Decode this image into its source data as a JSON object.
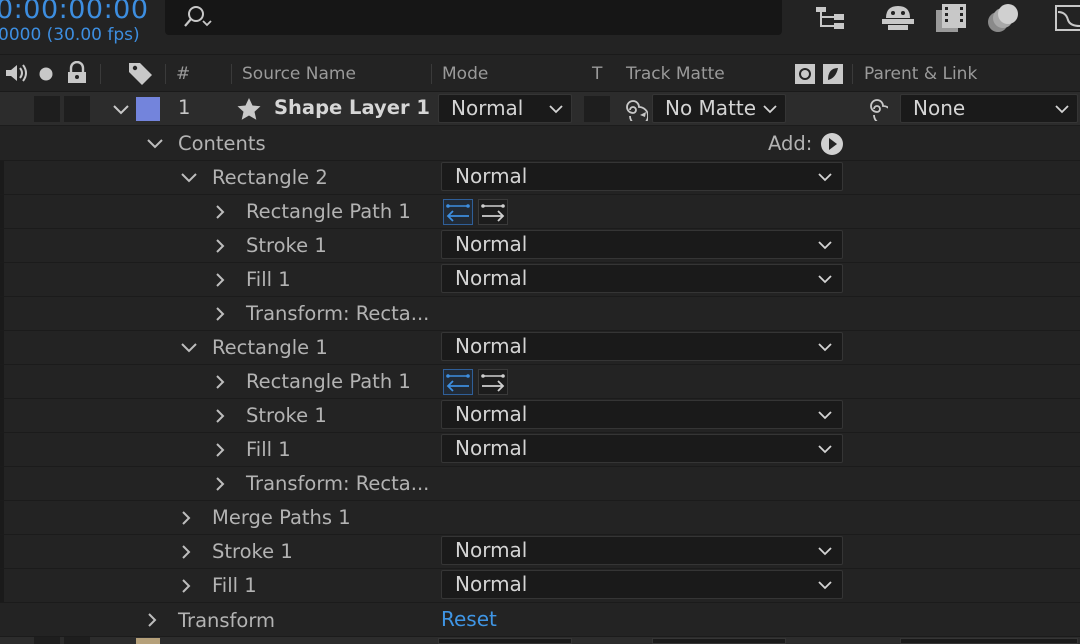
{
  "topbar": {
    "timecode": "0:00:00:00",
    "fps": "0000 (30.00 fps)",
    "search": {
      "placeholder": ""
    },
    "icons": [
      "flowchart-icon",
      "shy-layers-icon",
      "frame-blending-icon",
      "motion-blur-icon",
      "graph-editor-icon"
    ]
  },
  "header": {
    "hash": "#",
    "source_name": "Source Name",
    "mode": "Mode",
    "t": "T",
    "track_matte": "Track Matte",
    "parent_link": "Parent & Link"
  },
  "layer": {
    "number": "1",
    "name": "Shape Layer 1",
    "mode": "Normal",
    "track_matte": "No Matte",
    "parent": "None",
    "label_color": "#7384dc"
  },
  "contents": {
    "label": "Contents",
    "add_label": "Add:"
  },
  "properties": {
    "rect2": {
      "group": "Rectangle 2",
      "group_mode": "Normal",
      "path": "Rectangle Path 1",
      "stroke": "Stroke 1",
      "stroke_mode": "Normal",
      "fill": "Fill 1",
      "fill_mode": "Normal",
      "transform": "Transform: Recta..."
    },
    "rect1": {
      "group": "Rectangle 1",
      "group_mode": "Normal",
      "path": "Rectangle Path 1",
      "stroke": "Stroke 1",
      "stroke_mode": "Normal",
      "fill": "Fill 1",
      "fill_mode": "Normal",
      "transform": "Transform: Recta..."
    },
    "merge_paths": "Merge Paths 1",
    "stroke": "Stroke 1",
    "stroke_mode": "Normal",
    "fill": "Fill 1",
    "fill_mode": "Normal"
  },
  "transform": {
    "label": "Transform",
    "reset": "Reset"
  },
  "colors": {
    "accent": "#3d8ee0",
    "link": "#3f95e4",
    "background": "#232323",
    "layer_row": "#2c2c2c"
  }
}
